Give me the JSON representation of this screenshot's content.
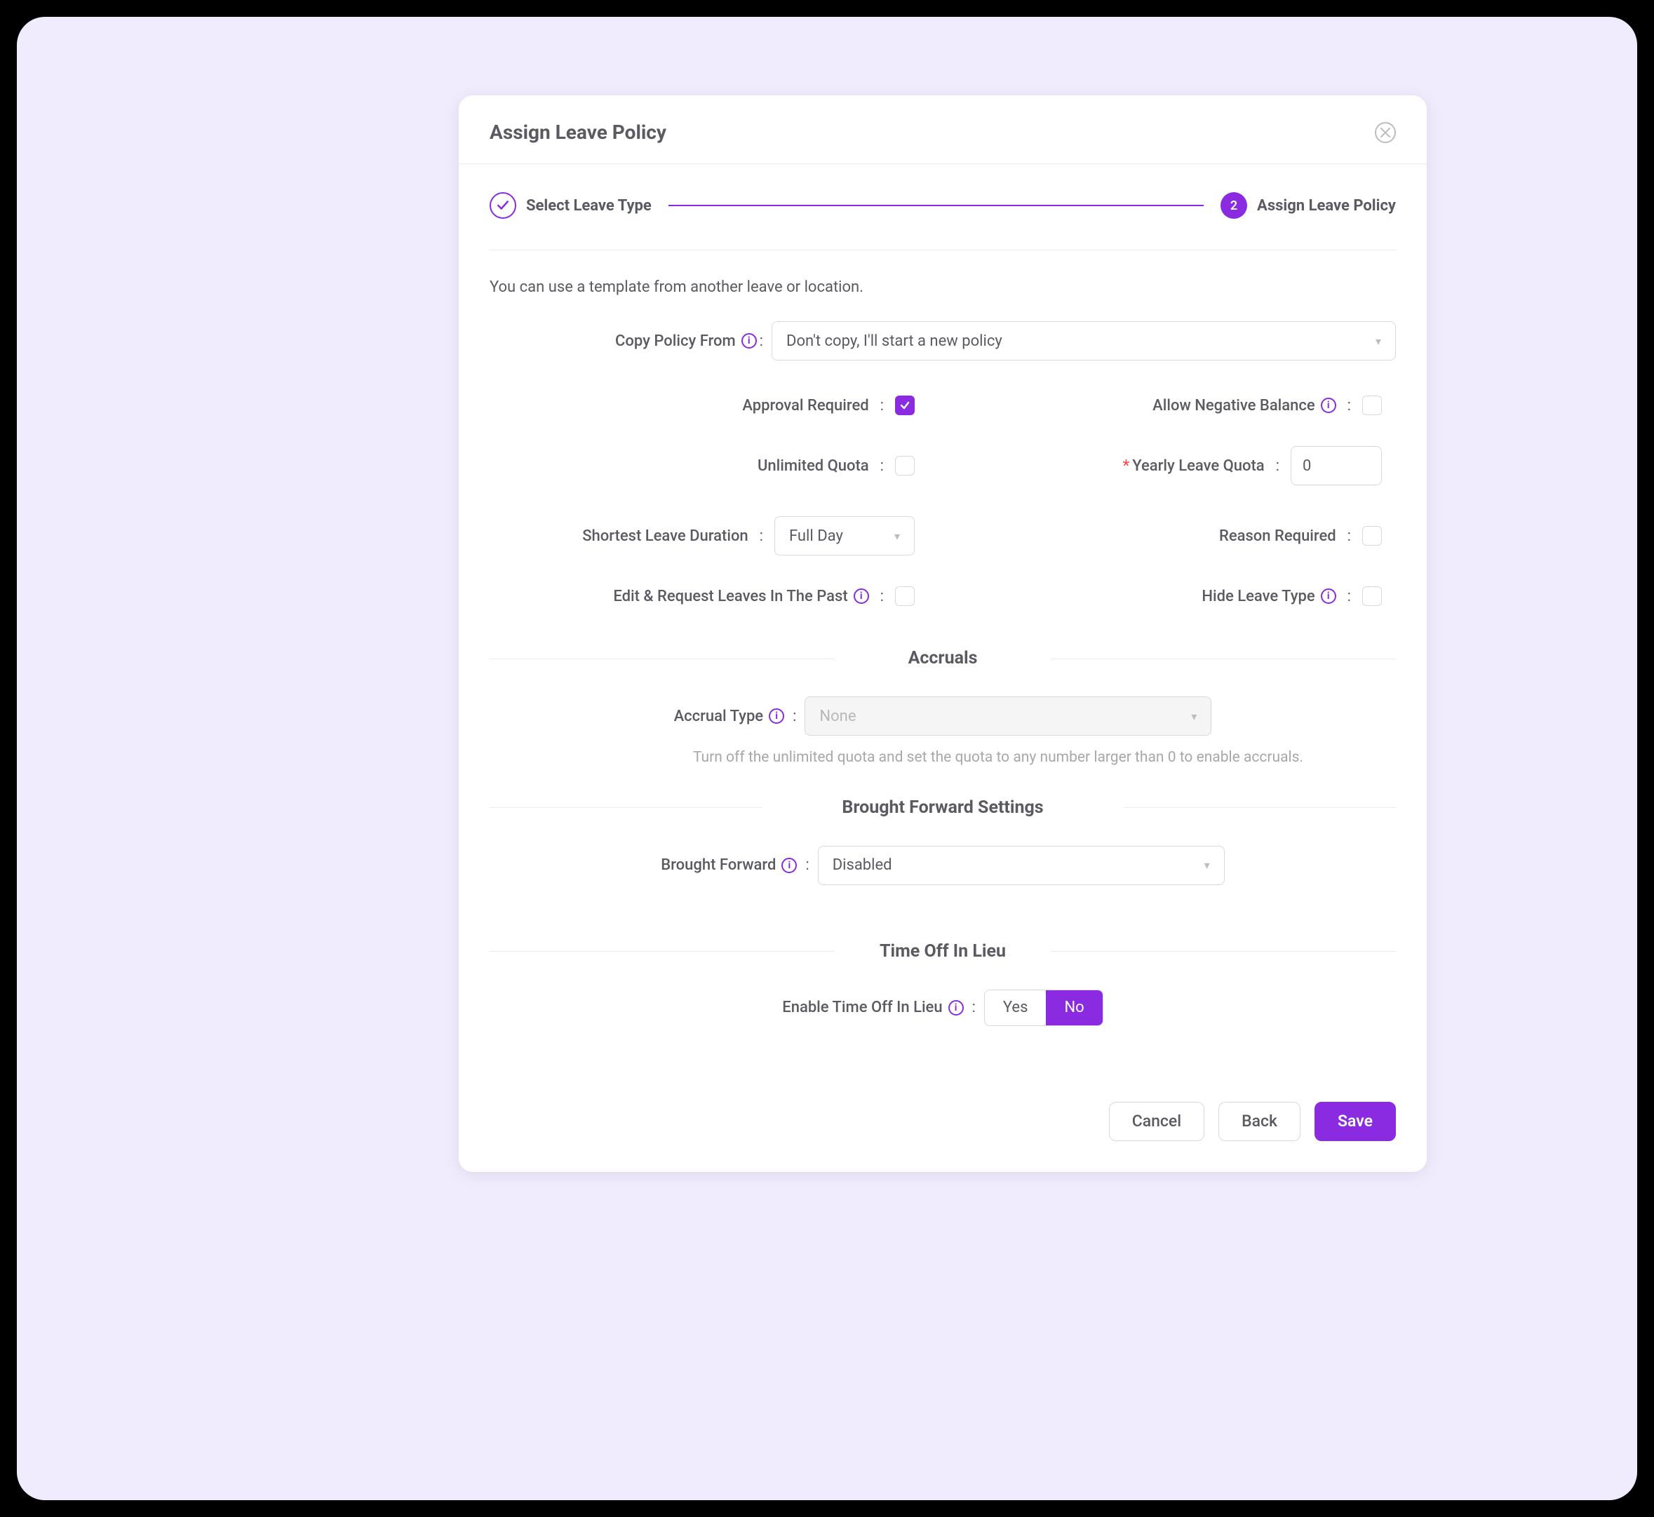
{
  "modal": {
    "title": "Assign Leave Policy"
  },
  "stepper": {
    "step1": {
      "label": "Select Leave Type"
    },
    "step2": {
      "number": "2",
      "label": "Assign Leave Policy"
    }
  },
  "intro": "You can use a template from another leave or location.",
  "fields": {
    "copyFrom": {
      "label": "Copy Policy From",
      "value": "Don't copy, I'll start a new policy"
    },
    "approvalRequired": {
      "label": "Approval Required"
    },
    "allowNegative": {
      "label": "Allow Negative Balance"
    },
    "unlimitedQuota": {
      "label": "Unlimited Quota"
    },
    "yearlyQuota": {
      "label": "Yearly Leave Quota",
      "value": "0"
    },
    "shortestDuration": {
      "label": "Shortest Leave Duration",
      "value": "Full Day"
    },
    "reasonRequired": {
      "label": "Reason Required"
    },
    "editPast": {
      "label": "Edit & Request Leaves In The Past"
    },
    "hideLeaveType": {
      "label": "Hide Leave Type"
    }
  },
  "sections": {
    "accruals": {
      "title": "Accruals",
      "typeLabel": "Accrual Type",
      "placeholder": "None",
      "hint": "Turn off the unlimited quota and set the quota to any number larger than 0 to enable accruals."
    },
    "broughtForward": {
      "title": "Brought Forward Settings",
      "label": "Brought Forward",
      "value": "Disabled"
    },
    "toil": {
      "title": "Time Off In Lieu",
      "label": "Enable Time Off In Lieu",
      "yes": "Yes",
      "no": "No"
    }
  },
  "footer": {
    "cancel": "Cancel",
    "back": "Back",
    "save": "Save"
  }
}
